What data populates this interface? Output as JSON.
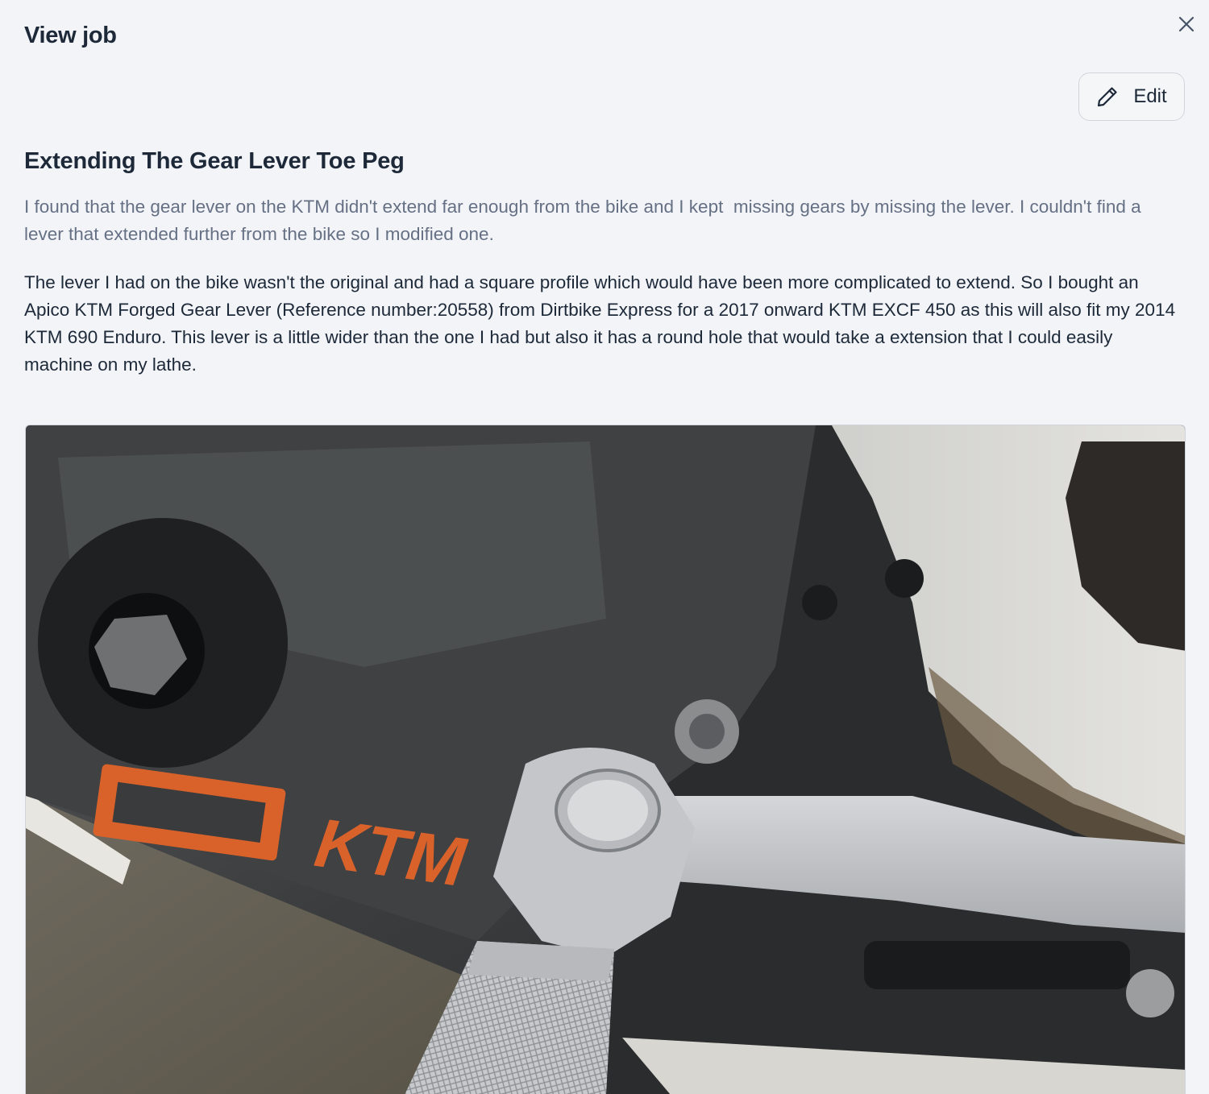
{
  "dialog": {
    "title": "View job",
    "close_icon": "close-icon"
  },
  "toolbar": {
    "edit_label": "Edit",
    "edit_icon": "pencil-icon"
  },
  "job": {
    "title": "Extending The Gear Lever Toe Peg",
    "summary": "I found that the gear lever on the KTM didn't extend far enough from the bike and I kept  missing gears by missing the lever. I couldn't find a lever that extended further from the bike so I modified one.",
    "body": "The lever I had on the bike wasn't the original and had a square profile which would have been more complicated to extend. So I bought an Apico KTM Forged Gear Lever (Reference number:20558) from Dirtbike Express for a 2017 onward KTM EXCF 450 as this will also fit my 2014 KTM 690 Enduro. This lever is a little wider than the one I had but also it has a round hole that would take a extension that I could easily machine on my lathe.",
    "photo": {
      "logo_text": "KTM"
    }
  },
  "colors": {
    "background": "#f2f4f7",
    "text_primary": "#1d2939",
    "text_muted": "#667085",
    "border": "#d0d5dd",
    "ktm_orange": "#d9622b"
  }
}
